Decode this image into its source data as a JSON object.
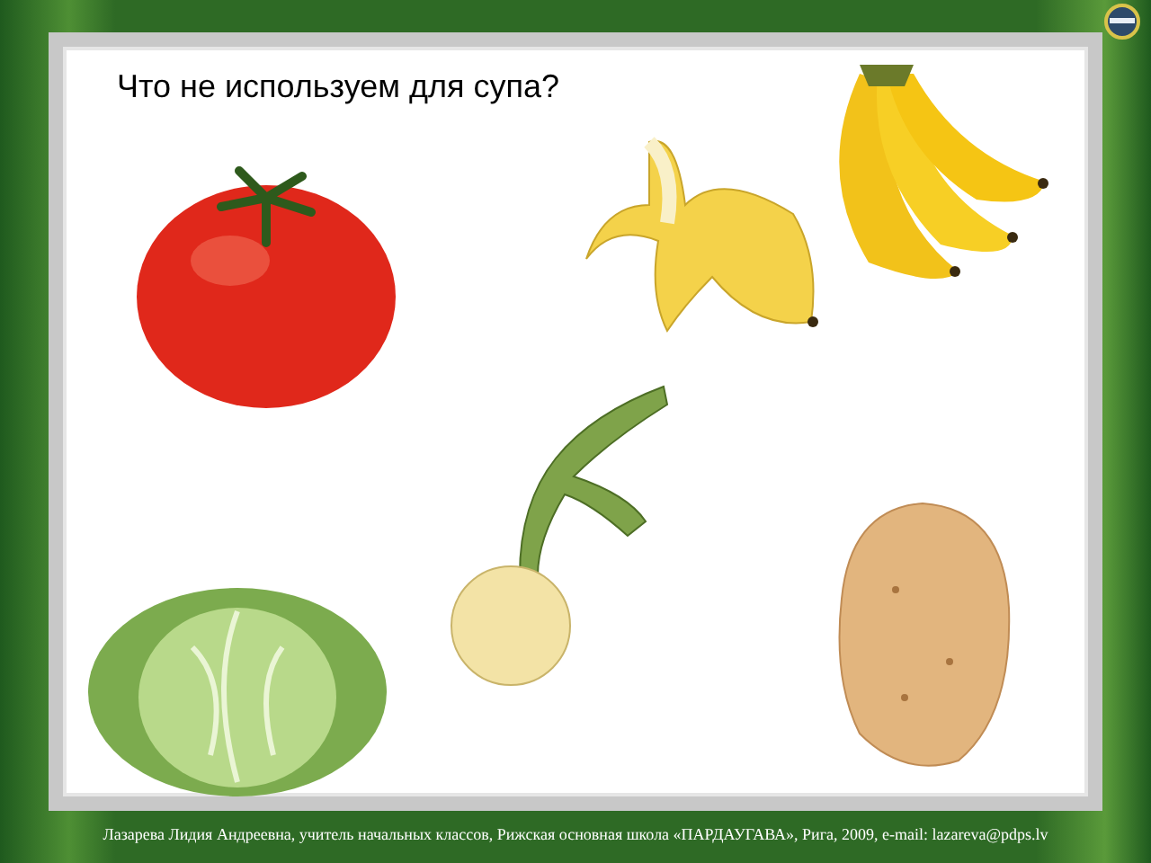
{
  "slide": {
    "question": "Что не используем для супа?"
  },
  "footer": "Лазарева Лидия Андреевна, учитель начальных классов, Рижская основная школа «ПАРДАУГАВА», Рига, 2009, e-mail: lazareva@pdps.lv"
}
